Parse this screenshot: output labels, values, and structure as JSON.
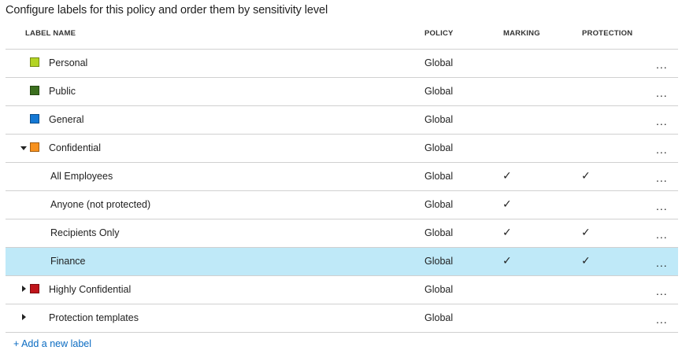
{
  "title": "Configure labels for this policy and order them by sensitivity level",
  "columns": {
    "label_name": "LABEL NAME",
    "policy": "POLICY",
    "marking": "MARKING",
    "protection": "PROTECTION"
  },
  "more_glyph": "...",
  "check_glyph": "✓",
  "rows": [
    {
      "name": "Personal",
      "policy": "Global",
      "marking": false,
      "protection": false,
      "level": 0,
      "color": "#b3d423",
      "caret": "none",
      "selected": false
    },
    {
      "name": "Public",
      "policy": "Global",
      "marking": false,
      "protection": false,
      "level": 0,
      "color": "#3b6f1e",
      "caret": "none",
      "selected": false
    },
    {
      "name": "General",
      "policy": "Global",
      "marking": false,
      "protection": false,
      "level": 0,
      "color": "#1478d4",
      "caret": "none",
      "selected": false
    },
    {
      "name": "Confidential",
      "policy": "Global",
      "marking": false,
      "protection": false,
      "level": 0,
      "color": "#f7911e",
      "caret": "down",
      "selected": false
    },
    {
      "name": "All Employees",
      "policy": "Global",
      "marking": true,
      "protection": true,
      "level": 1,
      "color": "",
      "caret": "none",
      "selected": false
    },
    {
      "name": "Anyone (not protected)",
      "policy": "Global",
      "marking": true,
      "protection": false,
      "level": 1,
      "color": "",
      "caret": "none",
      "selected": false
    },
    {
      "name": "Recipients Only",
      "policy": "Global",
      "marking": true,
      "protection": true,
      "level": 1,
      "color": "",
      "caret": "none",
      "selected": false
    },
    {
      "name": "Finance",
      "policy": "Global",
      "marking": true,
      "protection": true,
      "level": 1,
      "color": "",
      "caret": "none",
      "selected": true
    },
    {
      "name": "Highly Confidential",
      "policy": "Global",
      "marking": false,
      "protection": false,
      "level": 0,
      "color": "#c0151b",
      "caret": "right",
      "selected": false
    },
    {
      "name": "Protection templates",
      "policy": "Global",
      "marking": false,
      "protection": false,
      "level": 0,
      "color": "",
      "caret": "right",
      "selected": false
    }
  ],
  "add_link": "+ Add a new label",
  "colors": {
    "selected_row": "#bfe9f8",
    "link": "#0a6bc2",
    "divider": "#d0d0d0"
  }
}
